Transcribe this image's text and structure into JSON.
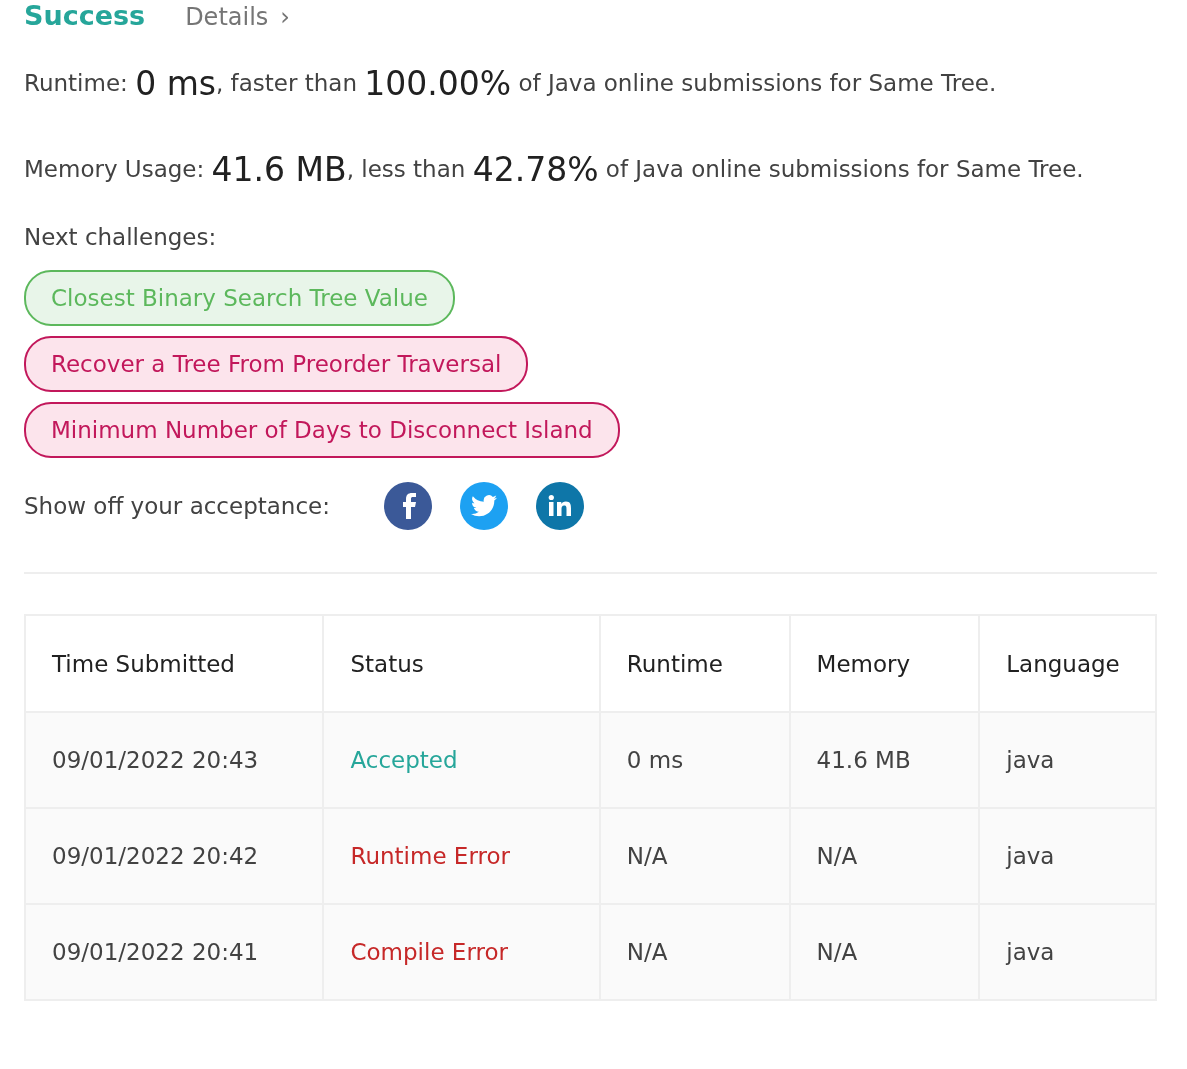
{
  "header": {
    "title": "Success",
    "details_link": "Details",
    "details_icon": "›"
  },
  "stats": [
    {
      "label": "Runtime:",
      "value": "0 ms",
      "comparison": ", faster than",
      "percent": "100.00%",
      "suffix": "of Java online submissions for Same Tree."
    },
    {
      "label": "Memory Usage:",
      "value": "41.6 MB",
      "comparison": ", less than",
      "percent": "42.78%",
      "suffix": "of Java online submissions for Same Tree."
    }
  ],
  "next_challenges": {
    "label": "Next challenges:",
    "items": [
      {
        "title": "Closest Binary Search Tree Value",
        "kind": "easy"
      },
      {
        "title": "Recover a Tree From Preorder Traversal",
        "kind": "hard"
      },
      {
        "title": "Minimum Number of Days to Disconnect Island",
        "kind": "hard"
      }
    ]
  },
  "share": {
    "label": "Show off your acceptance:",
    "networks": [
      {
        "kind": "facebook"
      },
      {
        "kind": "twitter"
      },
      {
        "kind": "linkedin"
      }
    ]
  },
  "table": {
    "columns": [
      "Time Submitted",
      "Status",
      "Runtime",
      "Memory",
      "Language"
    ],
    "rows": [
      {
        "time": "09/01/2022 20:43",
        "status": "Accepted",
        "kind": "accepted",
        "runtime": "0 ms",
        "memory": "41.6 MB",
        "language": "java"
      },
      {
        "time": "09/01/2022 20:42",
        "status": "Runtime Error",
        "kind": "error",
        "runtime": "N/A",
        "memory": "N/A",
        "language": "java"
      },
      {
        "time": "09/01/2022 20:41",
        "status": "Compile Error",
        "kind": "error",
        "runtime": "N/A",
        "memory": "N/A",
        "language": "java"
      }
    ]
  }
}
